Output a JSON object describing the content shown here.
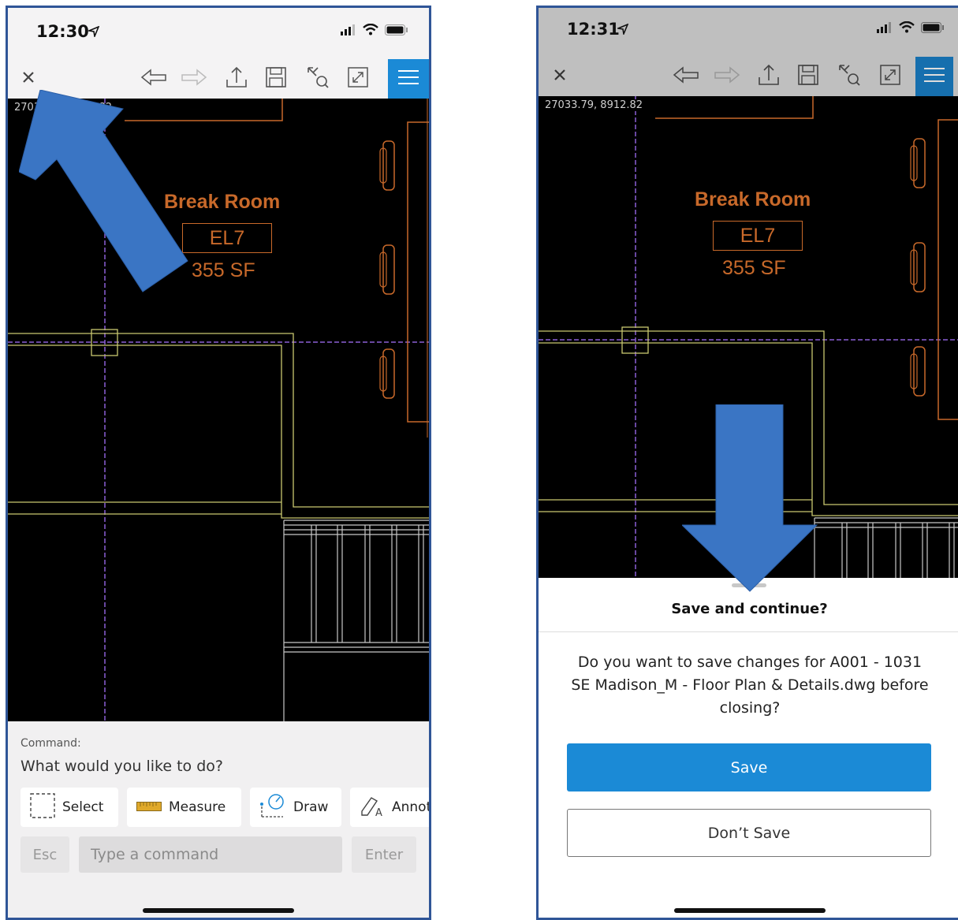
{
  "left_screen": {
    "status": {
      "time": "12:30"
    },
    "coordinate_readout": "27033.79, 8912.82",
    "room": {
      "name": "Break Room",
      "code": "EL7",
      "area": "355 SF"
    },
    "command": {
      "title": "Command:",
      "question": "What would you like to do?",
      "tools": [
        {
          "label": "Select",
          "icon": "select-icon"
        },
        {
          "label": "Measure",
          "icon": "ruler-icon"
        },
        {
          "label": "Draw",
          "icon": "draw-icon"
        },
        {
          "label": "Annotate",
          "icon": "annotate-icon"
        }
      ],
      "esc_label": "Esc",
      "input_placeholder": "Type a command",
      "enter_label": "Enter"
    }
  },
  "right_screen": {
    "status": {
      "time": "12:31"
    },
    "coordinate_readout": "27033.79, 8912.82",
    "room": {
      "name": "Break Room",
      "code": "EL7",
      "area": "355 SF"
    },
    "dialog": {
      "title": "Save and continue?",
      "message": "Do you want to save changes for A001 - 1031 SE Madison_M - Floor Plan & Details.dwg before closing?",
      "save_label": "Save",
      "dont_save_label": "Don’t Save"
    }
  },
  "toolbar_icons": [
    "close-icon",
    "undo-icon",
    "redo-icon",
    "share-icon",
    "save-icon",
    "zoom-extents-icon",
    "fullscreen-icon",
    "menu-icon"
  ],
  "colors": {
    "accent": "#1b8ad6",
    "annotation_arrow": "#3a75c4",
    "drawing_orange": "#c8692a",
    "drawing_yellow": "#c9c870",
    "grid_purple": "#8b5fd6",
    "drawing_background": "#000000"
  }
}
